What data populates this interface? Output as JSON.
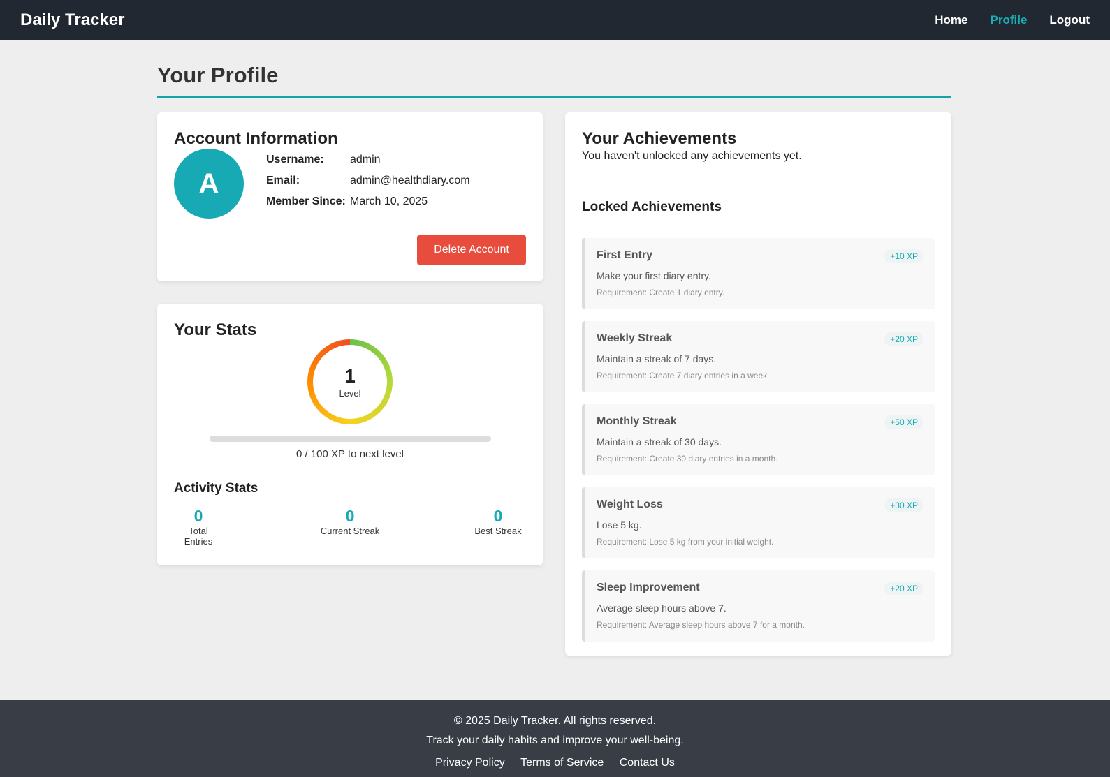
{
  "nav": {
    "brand": "Daily Tracker",
    "links": [
      "Home",
      "Profile",
      "Logout"
    ]
  },
  "page_title": "Your Profile",
  "account": {
    "title": "Account Information",
    "avatar_letter": "A",
    "username_label": "Username:",
    "username": "admin",
    "email_label": "Email:",
    "email": "admin@healthdiary.com",
    "member_label": "Member Since:",
    "member_since": "March 10, 2025",
    "delete_label": "Delete Account"
  },
  "stats": {
    "title": "Your Stats",
    "level": "1",
    "level_label": "Level",
    "xp_progress": 0,
    "xp_text": "0 / 100 XP to next level",
    "activity_title": "Activity Stats",
    "items": [
      {
        "value": "0",
        "label": "Total Entries"
      },
      {
        "value": "0",
        "label": "Current Streak"
      },
      {
        "value": "0",
        "label": "Best Streak"
      }
    ]
  },
  "achievements": {
    "title": "Your Achievements",
    "empty_text": "You haven't unlocked any achievements yet.",
    "locked_title": "Locked Achievements",
    "locked": [
      {
        "name": "First Entry",
        "xp": "+10 XP",
        "desc": "Make your first diary entry.",
        "req": "Requirement: Create 1 diary entry."
      },
      {
        "name": "Weekly Streak",
        "xp": "+20 XP",
        "desc": "Maintain a streak of 7 days.",
        "req": "Requirement: Create 7 diary entries in a week."
      },
      {
        "name": "Monthly Streak",
        "xp": "+50 XP",
        "desc": "Maintain a streak of 30 days.",
        "req": "Requirement: Create 30 diary entries in a month."
      },
      {
        "name": "Weight Loss",
        "xp": "+30 XP",
        "desc": "Lose 5 kg.",
        "req": "Requirement: Lose 5 kg from your initial weight."
      },
      {
        "name": "Sleep Improvement",
        "xp": "+20 XP",
        "desc": "Average sleep hours above 7.",
        "req": "Requirement: Average sleep hours above 7 for a month."
      }
    ]
  },
  "footer": {
    "copyright": "© 2025 Daily Tracker. All rights reserved.",
    "tagline": "Track your daily habits and improve your well-being.",
    "links": [
      "Privacy Policy",
      "Terms of Service",
      "Contact Us"
    ]
  },
  "colors": {
    "accent": "#17aab4",
    "danger": "#e74c3c",
    "navbar": "#222831",
    "footer": "#393e46"
  }
}
